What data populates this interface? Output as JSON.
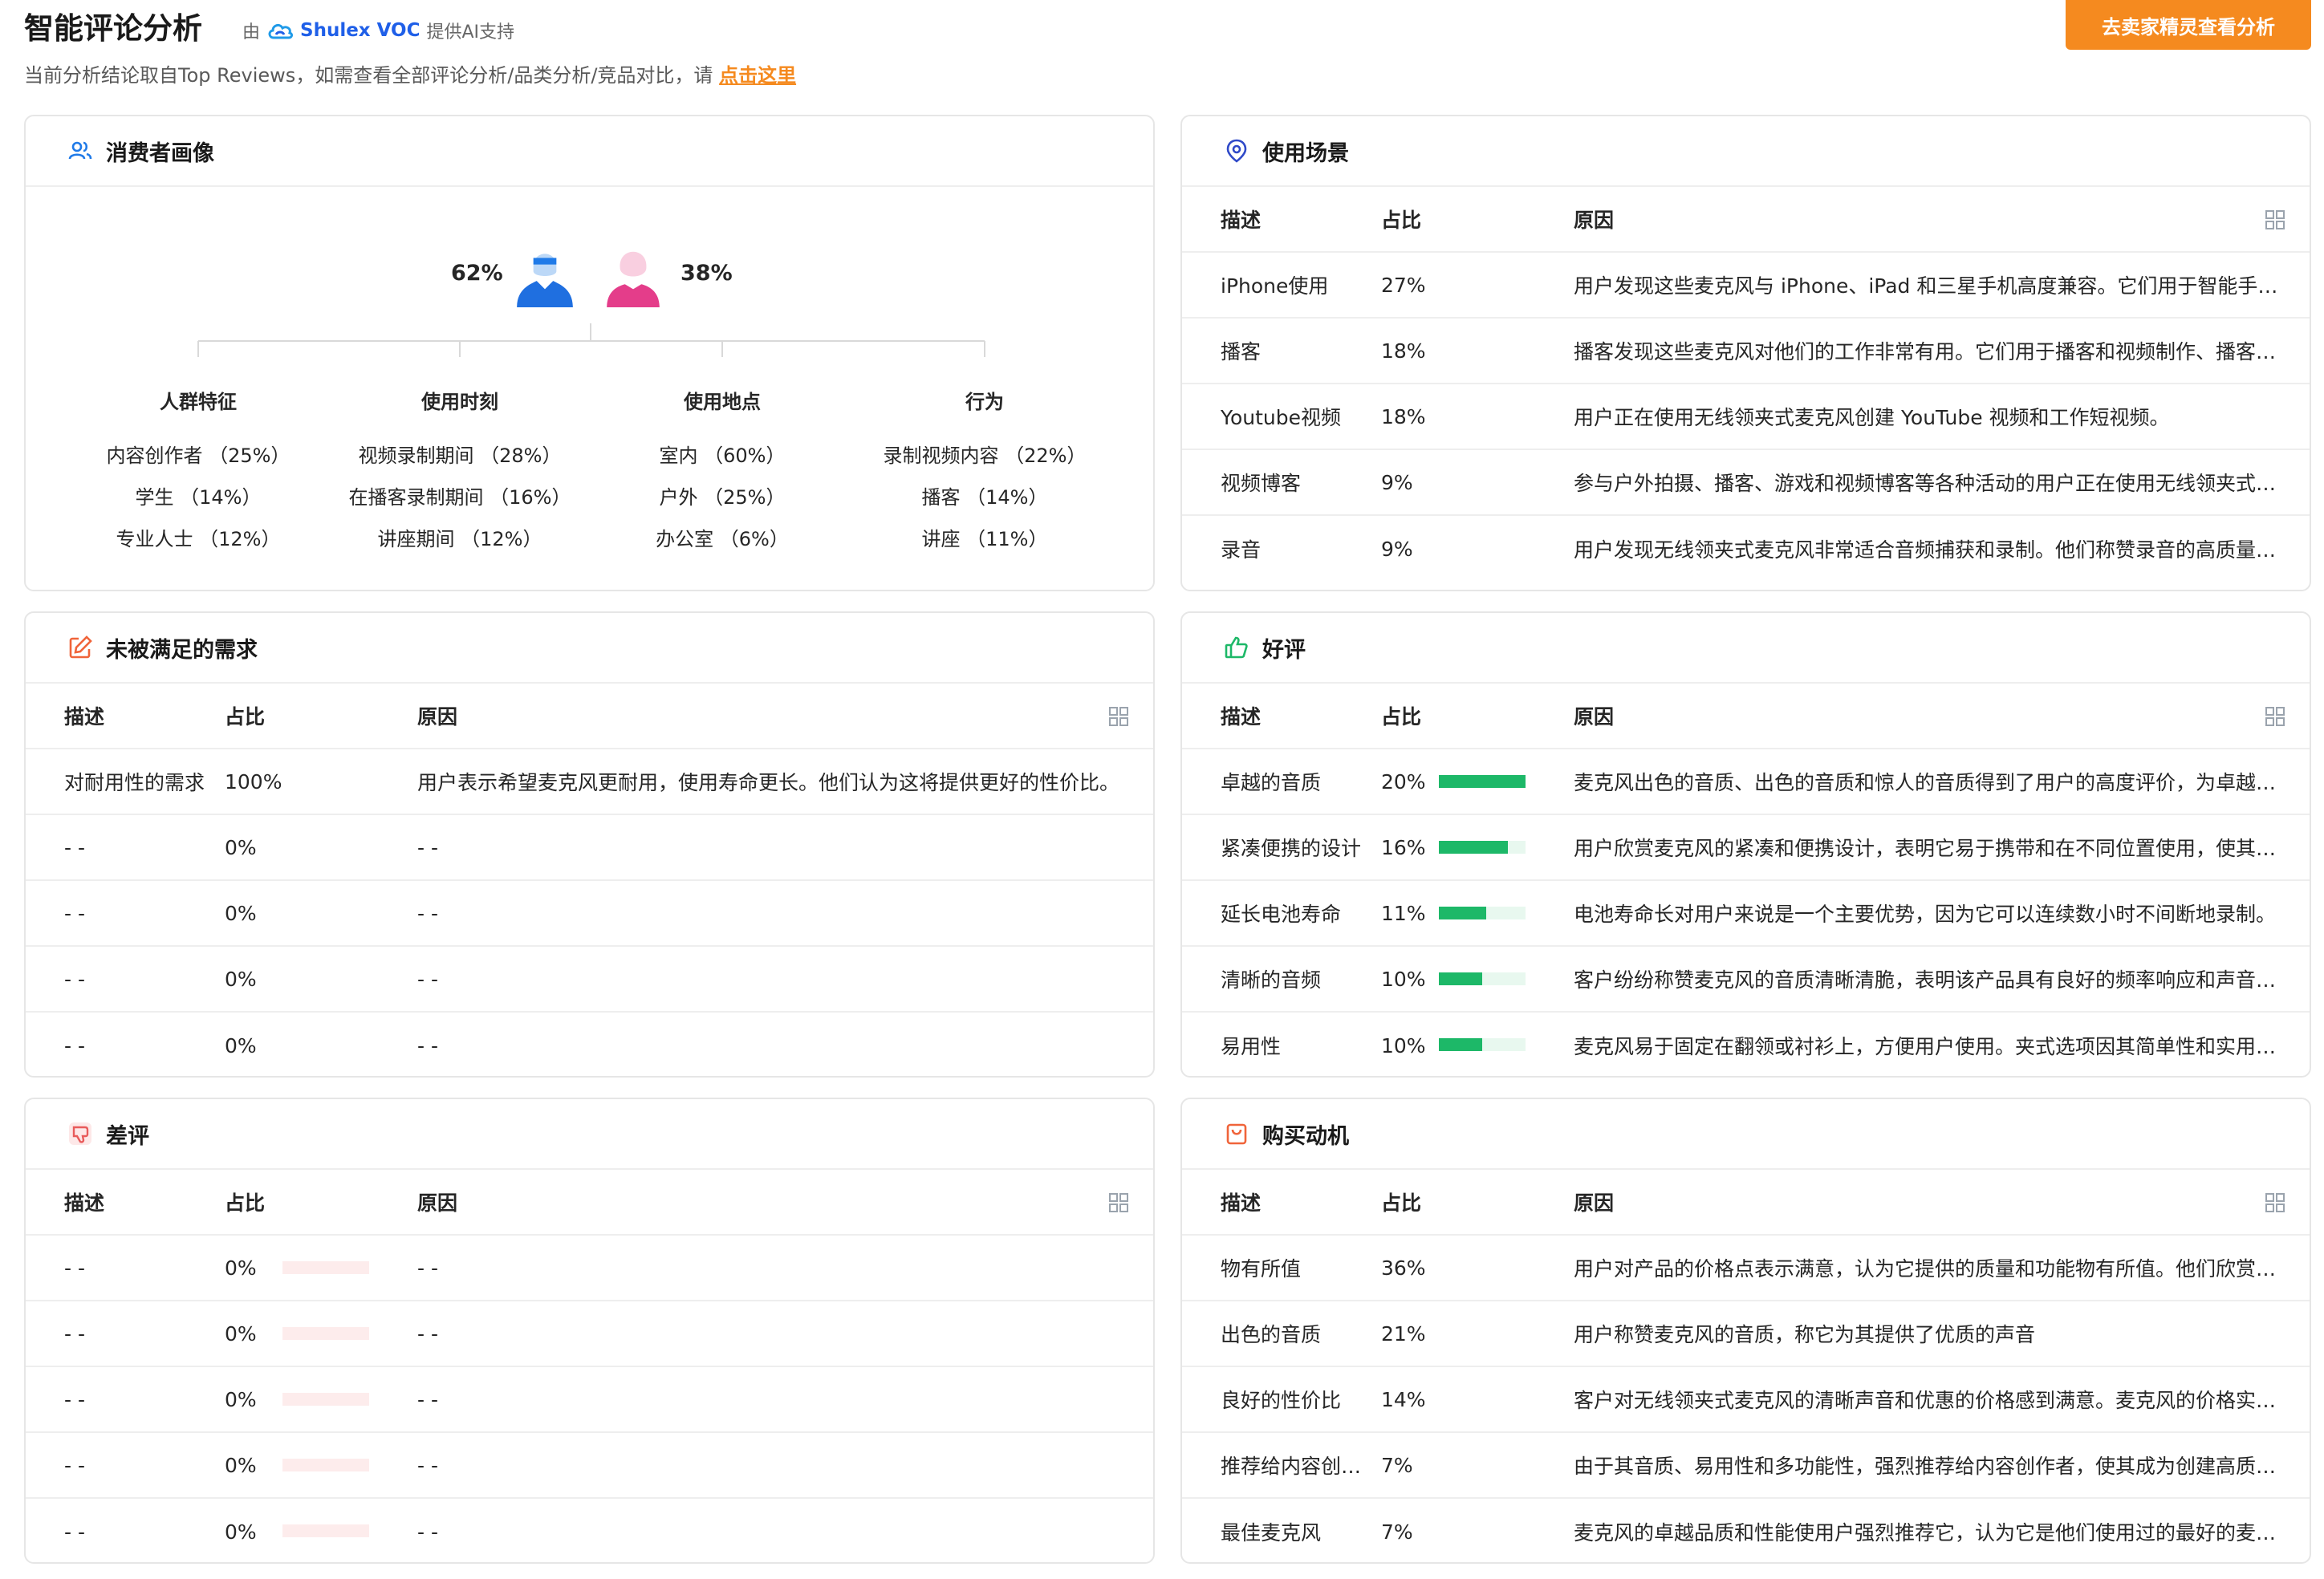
{
  "header": {
    "title": "智能评论分析",
    "by": "由",
    "brand": "Shulex VOC",
    "powered": "提供AI支持",
    "cta": "去卖家精灵查看分析",
    "subtitle": "当前分析结论取自Top Reviews，如需查看全部评论分析/品类分析/竞品对比，请",
    "subtitle_link": "点击这里"
  },
  "colors": {
    "accent": "#f58a1f",
    "brand": "#1f5fe8",
    "good_bar": "#1db868",
    "bad_bar": "#fde8e8"
  },
  "table_headers": {
    "desc": "描述",
    "ratio": "占比",
    "reason": "原因"
  },
  "persona": {
    "title": "消费者画像",
    "male_pct": "62%",
    "female_pct": "38%",
    "columns": [
      {
        "title": "人群特征",
        "items": [
          "内容创作者 （25%）",
          "学生 （14%）",
          "专业人士 （12%）"
        ]
      },
      {
        "title": "使用时刻",
        "items": [
          "视频录制期间 （28%）",
          "在播客录制期间 （16%）",
          "讲座期间 （12%）"
        ]
      },
      {
        "title": "使用地点",
        "items": [
          "室内 （60%）",
          "户外 （25%）",
          "办公室 （6%）"
        ]
      },
      {
        "title": "行为",
        "items": [
          "录制视频内容 （22%）",
          "播客 （14%）",
          "讲座 （11%）"
        ]
      }
    ]
  },
  "scenes": {
    "title": "使用场景",
    "rows": [
      {
        "desc": "iPhone使用",
        "ratio": "27%",
        "reason": "用户发现这些麦克风与 iPhone、iPad 和三星手机高度兼容。它们用于智能手机录制视频和音频。"
      },
      {
        "desc": "播客",
        "ratio": "18%",
        "reason": "播客发现这些麦克风对他们的工作非常有用。它们用于播客和视频制作、播客录制和采访。"
      },
      {
        "desc": "Youtube视频",
        "ratio": "18%",
        "reason": "用户正在使用无线领夹式麦克风创建 YouTube 视频和工作短视频。"
      },
      {
        "desc": "视频博客",
        "ratio": "9%",
        "reason": "参与户外拍摄、播客、游戏和视频博客等各种活动的用户正在使用无线领夹式麦克风。"
      },
      {
        "desc": "录音",
        "ratio": "9%",
        "reason": "用户发现无线领夹式麦克风非常适合音频捕获和录制。他们称赞录音的高质量和清晰度。"
      }
    ]
  },
  "unmet": {
    "title": "未被满足的需求",
    "rows": [
      {
        "desc": "对耐用性的需求",
        "ratio": "100%",
        "reason": "用户表示希望麦克风更耐用，使用寿命更长。他们认为这将提供更好的性价比。"
      },
      {
        "desc": "- -",
        "ratio": "0%",
        "reason": "- -"
      },
      {
        "desc": "- -",
        "ratio": "0%",
        "reason": "- -"
      },
      {
        "desc": "- -",
        "ratio": "0%",
        "reason": "- -"
      },
      {
        "desc": "- -",
        "ratio": "0%",
        "reason": "- -"
      }
    ]
  },
  "good": {
    "title": "好评",
    "rows": [
      {
        "desc": "卓越的音质",
        "ratio": "20%",
        "level": 1.0,
        "reason": "麦克风出色的音质、出色的音质和惊人的音质得到了用户的高度评价，为卓越的音频体验做出了贡献。"
      },
      {
        "desc": "紧凑便携的设计",
        "ratio": "16%",
        "level": 0.8,
        "reason": "用户欣赏麦克风的紧凑和便携设计，表明它易于携带和在不同位置使用，使其成为旅行的理想选择。"
      },
      {
        "desc": "延长电池寿命",
        "ratio": "11%",
        "level": 0.55,
        "reason": "电池寿命长对用户来说是一个主要优势，因为它可以连续数小时不间断地录制。"
      },
      {
        "desc": "清晰的音频",
        "ratio": "10%",
        "level": 0.5,
        "reason": "客户纷纷称赞麦克风的音质清晰清脆，表明该产品具有良好的频率响应和声音再现。"
      },
      {
        "desc": "易用性",
        "ratio": "10%",
        "level": 0.5,
        "reason": "麦克风易于固定在翻领或衬衫上，方便用户使用。夹式选项因其简单性和实用性而受到称赞。"
      }
    ]
  },
  "bad": {
    "title": "差评",
    "rows": [
      {
        "desc": "- -",
        "ratio": "0%",
        "level": 0,
        "reason": "- -"
      },
      {
        "desc": "- -",
        "ratio": "0%",
        "level": 0,
        "reason": "- -"
      },
      {
        "desc": "- -",
        "ratio": "0%",
        "level": 0,
        "reason": "- -"
      },
      {
        "desc": "- -",
        "ratio": "0%",
        "level": 0,
        "reason": "- -"
      },
      {
        "desc": "- -",
        "ratio": "0%",
        "level": 0,
        "reason": "- -"
      }
    ]
  },
  "motive": {
    "title": "购买动机",
    "rows": [
      {
        "desc": "物有所值",
        "ratio": "36%",
        "reason": "用户对产品的价格点表示满意，认为它提供的质量和功能物有所值。他们欣赏其合理的价格。"
      },
      {
        "desc": "出色的音质",
        "ratio": "21%",
        "reason": "用户称赞麦克风的音质，称它为其提供了优质的声音"
      },
      {
        "desc": "良好的性价比",
        "ratio": "14%",
        "reason": "客户对无线领夹式麦克风的清晰声音和优惠的价格感到满意。麦克风的价格实惠是一大优点。"
      },
      {
        "desc": "推荐给内容创作者",
        "ratio": "7%",
        "reason": "由于其音质、易用性和多功能性，强烈推荐给内容创作者，使其成为创建高质量内容的理想选择。"
      },
      {
        "desc": "最佳麦克风",
        "ratio": "7%",
        "reason": "麦克风的卓越品质和性能使用户强烈推荐它，认为它是他们使用过的最好的麦克风。"
      }
    ]
  }
}
